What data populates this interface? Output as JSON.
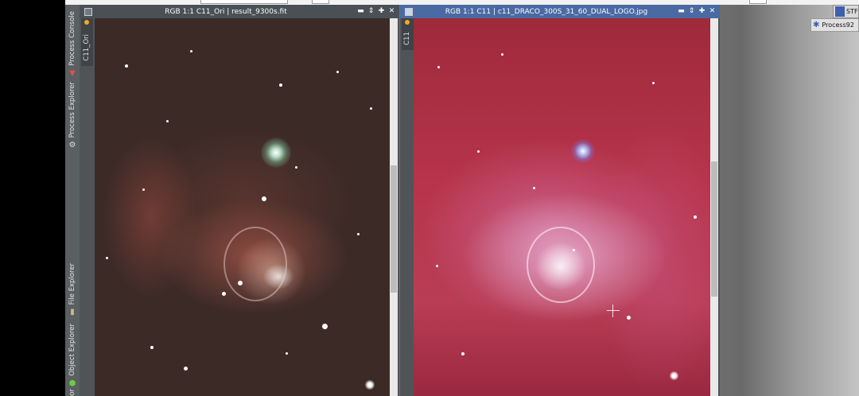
{
  "side_panel": {
    "tabs": [
      {
        "label": "Process Console",
        "icon": "console-icon"
      },
      {
        "label": "Process Explorer",
        "icon": "gear-icon"
      },
      {
        "label": "File Explorer",
        "icon": "cylinder-icon"
      },
      {
        "label": "Object Explorer",
        "icon": "object-icon"
      },
      {
        "label": "or"
      }
    ]
  },
  "left_window": {
    "title": "RGB 1:1 C11_Ori | result_9300s.fit",
    "view_tab": "C11_Ori",
    "buttons": {
      "minimize": "▬",
      "shade": "⇕",
      "maximize": "✚",
      "close": "✕"
    }
  },
  "right_window": {
    "title": "RGB 1:1 C11 | c11_DRACO_300S_31_60_DUAL_LOGO.jpg",
    "view_tab": "C11",
    "buttons": {
      "minimize": "▬",
      "shade": "⇕",
      "maximize": "✚",
      "close": "✕"
    }
  },
  "icons": {
    "stf": {
      "label": "STF"
    },
    "process": {
      "label": "Process92"
    }
  },
  "colors": {
    "title_bar_left": "#4a5055",
    "title_bar_right": "#4a6aa3",
    "nebula_left": "#3c2a27",
    "nebula_right": "#b8344c"
  }
}
